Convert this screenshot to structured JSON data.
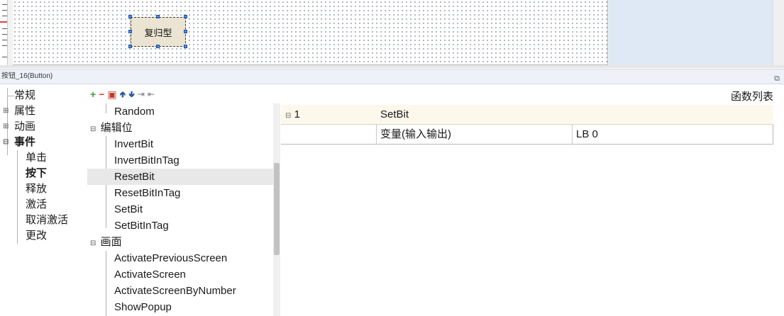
{
  "canvas": {
    "button_widget_label": "复归型"
  },
  "panel": {
    "title": "按钮_16(Button)",
    "pin_icon": "restore-icon"
  },
  "categories": [
    {
      "label": "常规",
      "bold": false
    },
    {
      "label": "属性",
      "bold": false
    },
    {
      "label": "动画",
      "bold": false
    },
    {
      "label": "事件",
      "bold": true
    },
    {
      "label": "单击",
      "bold": false
    },
    {
      "label": "按下",
      "bold": true
    },
    {
      "label": "释放",
      "bold": false
    },
    {
      "label": "激活",
      "bold": false
    },
    {
      "label": "取消激活",
      "bold": false
    },
    {
      "label": "更改",
      "bold": false
    }
  ],
  "toolbar": {
    "icons": [
      "add-icon",
      "remove-icon",
      "delete-icon",
      "move-up-icon",
      "move-down-icon",
      "indent-icon",
      "outdent-icon"
    ],
    "colors": {
      "add": "#3aa13a",
      "remove": "#d93a3a",
      "delete": "#c0392b",
      "arrows": "#2b579a",
      "indent": "#7a7a7a"
    }
  },
  "functions": [
    {
      "label": "Random",
      "group": false
    },
    {
      "label": "编辑位",
      "group": true
    },
    {
      "label": "InvertBit",
      "group": false
    },
    {
      "label": "InvertBitInTag",
      "group": false
    },
    {
      "label": "ResetBit",
      "group": false,
      "selected": true
    },
    {
      "label": "ResetBitInTag",
      "group": false
    },
    {
      "label": "SetBit",
      "group": false
    },
    {
      "label": "SetBitInTag",
      "group": false
    },
    {
      "label": "画面",
      "group": true
    },
    {
      "label": "ActivatePreviousScreen",
      "group": false
    },
    {
      "label": "ActivateScreen",
      "group": false
    },
    {
      "label": "ActivateScreenByNumber",
      "group": false
    },
    {
      "label": "ShowPopup",
      "group": false
    }
  ],
  "function_list": {
    "title": "函数列表",
    "entries": [
      {
        "index": "1",
        "name": "SetBit",
        "params": [
          {
            "name": "变量(输入输出)",
            "value": "LB 0"
          }
        ]
      }
    ]
  }
}
